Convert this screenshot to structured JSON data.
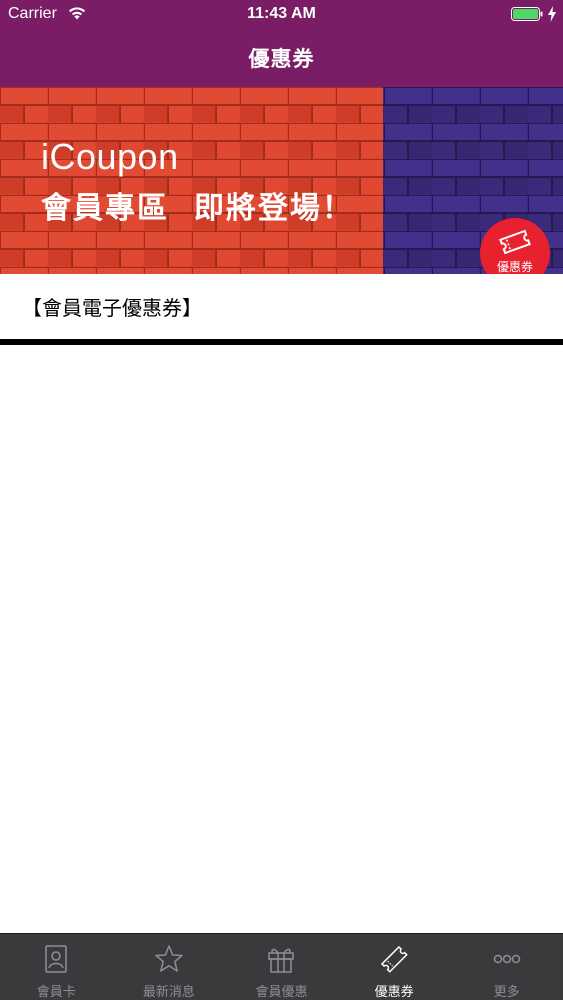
{
  "status_bar": {
    "carrier": "Carrier",
    "time": "11:43 AM",
    "wifi_icon": "wifi-icon",
    "battery_icon": "battery-full-icon",
    "charging_icon": "charging-bolt-icon"
  },
  "nav": {
    "title": "優惠券"
  },
  "banner": {
    "title": "iCoupon",
    "subtitle": "會員專區  即將登場！",
    "badge_label": "優惠券",
    "badge_icon": "ticket-icon"
  },
  "section": {
    "heading": "【會員電子優惠券】"
  },
  "tab_bar": {
    "items": [
      {
        "label": "會員卡",
        "icon": "member-card-icon",
        "active": false
      },
      {
        "label": "最新消息",
        "icon": "star-icon",
        "active": false
      },
      {
        "label": "會員優惠",
        "icon": "gift-icon",
        "active": false
      },
      {
        "label": "優惠券",
        "icon": "ticket-icon",
        "active": true
      },
      {
        "label": "更多",
        "icon": "more-icon",
        "active": false
      }
    ]
  },
  "colors": {
    "header": "#7a1d66",
    "brick_red": "#d8412b",
    "brick_purple": "#3b2a7a",
    "badge": "#e8212e",
    "tab_bar": "#3a3a3c",
    "tab_inactive": "#8e8e93",
    "tab_active": "#ffffff"
  }
}
